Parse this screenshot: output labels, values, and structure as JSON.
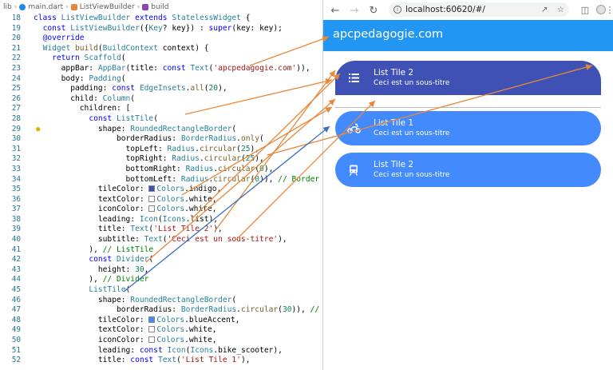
{
  "breadcrumb": {
    "items": [
      "lib",
      "main.dart",
      "ListViewBuilder",
      "build"
    ]
  },
  "code": [
    {
      "n": "18",
      "html": "<span class='kw'>class</span> <span class='ty'>ListViewBuilder</span> <span class='kw'>extends</span> <span class='ty'>StatelessWidget</span> {"
    },
    {
      "n": "19",
      "html": "  <span class='kw'>const</span> <span class='ty'>ListViewBuilder</span>({<span class='ty'>Key</span>? key}) : <span class='kw'>super</span>(key: key);"
    },
    {
      "n": "20",
      "html": "  <span class='kw'>@override</span>"
    },
    {
      "n": "21",
      "html": "  <span class='ty'>Widget</span> <span class='fn'>build</span>(<span class='ty'>BuildContext</span> context) {"
    },
    {
      "n": "22",
      "html": "    <span class='kw'>return</span> <span class='ty'>Scaffold</span>("
    },
    {
      "n": "23",
      "html": "      appBar: <span class='ty'>AppBar</span>(title: <span class='kw'>const</span> <span class='ty'>Text</span>(<span class='str'>'apcpedagogie.com'</span>)),"
    },
    {
      "n": "24",
      "html": "      body: <span class='ty'>Padding</span>("
    },
    {
      "n": "25",
      "html": "        padding: <span class='kw'>const</span> <span class='ty'>EdgeInsets</span>.<span class='fn'>all</span>(<span class='num'>20</span>),"
    },
    {
      "n": "26",
      "html": "        child: <span class='ty'>Column</span>("
    },
    {
      "n": "27",
      "html": "          children: ["
    },
    {
      "n": "28",
      "html": "            <span class='kw'>const</span> <span class='ty'>ListTile</span>("
    },
    {
      "n": "29",
      "html": "              shape: <span class='ty'>RoundedRectangleBorder</span>("
    },
    {
      "n": "30",
      "html": "                  borderRadius: <span class='ty'>BorderRadius</span>.<span class='fn'>only</span>("
    },
    {
      "n": "31",
      "html": "                    topLeft: <span class='ty'>Radius</span>.<span class='fn'>circular</span>(<span class='num'>25</span>),"
    },
    {
      "n": "32",
      "html": "                    topRight: <span class='ty'>Radius</span>.<span class='fn'>circular</span>(<span class='num'>25</span>),"
    },
    {
      "n": "33",
      "html": "                    bottomRight: <span class='ty'>Radius</span>.<span class='fn'>circular</span>(<span class='num'>0</span>),"
    },
    {
      "n": "34",
      "html": "                    bottomLeft: <span class='ty'>Radius</span>.<span class='fn'>circular</span>(<span class='num'>0</span>)), <span class='cm'>// Border</span>"
    },
    {
      "n": "35",
      "html": "              tileColor: <span class='swatch' style='background:#3f51b5'></span><span class='ty'>Colors</span>.indigo,"
    },
    {
      "n": "36",
      "html": "              textColor: <span class='swatch' style='background:#ffffff'></span><span class='ty'>Colors</span>.white,"
    },
    {
      "n": "37",
      "html": "              iconColor: <span class='swatch' style='background:#ffffff'></span><span class='ty'>Colors</span>.white,"
    },
    {
      "n": "38",
      "html": "              leading: <span class='ty'>Icon</span>(<span class='ty'>Icons</span>.list),"
    },
    {
      "n": "39",
      "html": "              title: <span class='ty'>Text</span>(<span class='str'>'List Tile 2'</span>),"
    },
    {
      "n": "40",
      "html": "              subtitle: <span class='ty'>Text</span>(<span class='str'>'Ceci est un sous-titre'</span>),"
    },
    {
      "n": "41",
      "html": "            ), <span class='cm'>// ListTile</span>"
    },
    {
      "n": "42",
      "html": "            <span class='kw'>const</span> <span class='ty'>Divider</span>("
    },
    {
      "n": "43",
      "html": "              height: <span class='num'>30</span>,"
    },
    {
      "n": "44",
      "html": "            ), <span class='cm'>// Divider</span>"
    },
    {
      "n": "45",
      "html": "            <span class='ty'>ListTile</span>("
    },
    {
      "n": "46",
      "html": "              shape: <span class='ty'>RoundedRectangleBorder</span>("
    },
    {
      "n": "47",
      "html": "                  borderRadius: <span class='ty'>BorderRadius</span>.<span class='fn'>circular</span>(<span class='num'>30</span>)), <span class='cm'>// R</span>"
    },
    {
      "n": "48",
      "html": "              tileColor: <span class='swatch' style='background:#448aff'></span><span class='ty'>Colors</span>.blueAccent,"
    },
    {
      "n": "49",
      "html": "              textColor: <span class='swatch' style='background:#ffffff'></span><span class='ty'>Colors</span>.white,"
    },
    {
      "n": "50",
      "html": "              iconColor: <span class='swatch' style='background:#ffffff'></span><span class='ty'>Colors</span>.white,"
    },
    {
      "n": "51",
      "html": "              leading: <span class='kw'>const</span> <span class='ty'>Icon</span>(<span class='ty'>Icons</span>.bike_scooter),"
    },
    {
      "n": "52",
      "html": "              title: <span class='kw'>const</span> <span class='ty'>Text</span>(<span class='str'>'List Tile 1'</span>),"
    }
  ],
  "browser": {
    "url": "localhost:60620/#/",
    "back_icon": "arrow-left-icon",
    "forward_icon": "arrow-right-icon",
    "reload_icon": "reload-icon"
  },
  "app": {
    "title": "apcpedagogie.com",
    "appbar_color": "#2196f3",
    "tiles": [
      {
        "title": "List Tile 2",
        "subtitle": "Ceci est un sous-titre",
        "icon": "list-icon",
        "color": "#3f51b5"
      },
      {
        "title": "List Tile 1",
        "subtitle": "Ceci est un sous-titre",
        "icon": "bike-scooter-icon",
        "color": "#448aff"
      },
      {
        "title": "List Tile 2",
        "subtitle": "Ceci est un sous-titre",
        "icon": "train-icon",
        "color": "#448aff"
      }
    ]
  },
  "colors": {
    "annotation_orange": "#e8873a",
    "annotation_blue": "#3a6fc4"
  }
}
